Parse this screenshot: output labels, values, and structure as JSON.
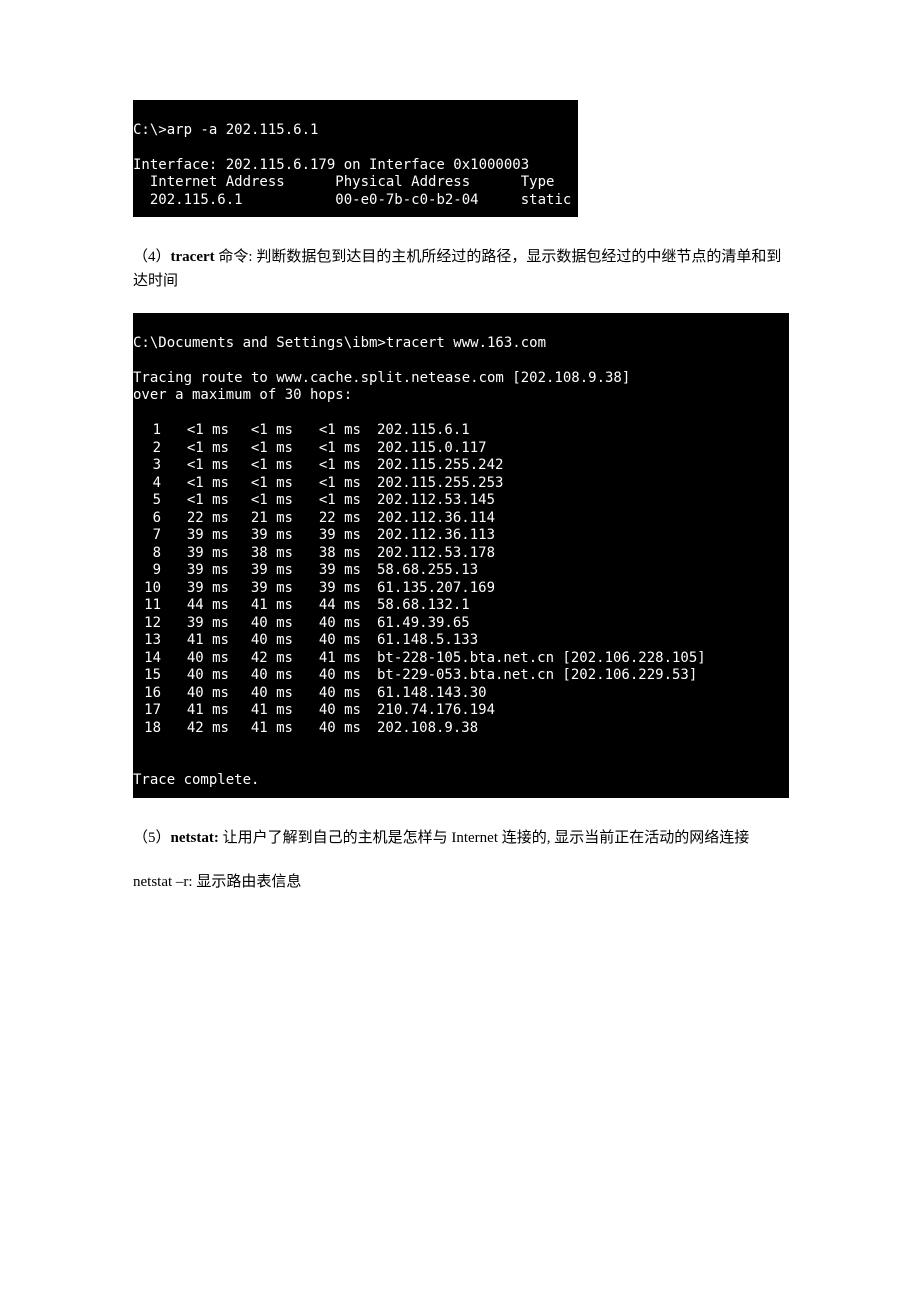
{
  "arp": {
    "prompt": "C:\\>arp -a 202.115.6.1",
    "interface_line": "Interface: 202.115.6.179 on Interface 0x1000003",
    "h1": "Internet Address",
    "h2": "Physical Address",
    "h3": "Type",
    "ip": "202.115.6.1",
    "mac": "00-e0-7b-c0-b2-04",
    "type": "static"
  },
  "p4": {
    "prefix": "（4）",
    "cmd": "tracert",
    "mid": " 命令:  ",
    "rest": "判断数据包到达目的主机所经过的路径，显示数据包经过的中继节点的清单和到达时间"
  },
  "tracert": {
    "prompt": "C:\\Documents and Settings\\ibm>tracert www.163.com",
    "tracing1": "Tracing route to www.cache.split.netease.com [202.108.9.38]",
    "tracing2": "over a maximum of 30 hops:",
    "complete": "Trace complete.",
    "hops": [
      {
        "n": "1",
        "a": "<1 ms",
        "b": "<1 ms",
        "c": "<1 ms",
        "d": "202.115.6.1"
      },
      {
        "n": "2",
        "a": "<1 ms",
        "b": "<1 ms",
        "c": "<1 ms",
        "d": "202.115.0.117"
      },
      {
        "n": "3",
        "a": "<1 ms",
        "b": "<1 ms",
        "c": "<1 ms",
        "d": "202.115.255.242"
      },
      {
        "n": "4",
        "a": "<1 ms",
        "b": "<1 ms",
        "c": "<1 ms",
        "d": "202.115.255.253"
      },
      {
        "n": "5",
        "a": "<1 ms",
        "b": "<1 ms",
        "c": "<1 ms",
        "d": "202.112.53.145"
      },
      {
        "n": "6",
        "a": "22 ms",
        "b": "21 ms",
        "c": "22 ms",
        "d": "202.112.36.114"
      },
      {
        "n": "7",
        "a": "39 ms",
        "b": "39 ms",
        "c": "39 ms",
        "d": "202.112.36.113"
      },
      {
        "n": "8",
        "a": "39 ms",
        "b": "38 ms",
        "c": "38 ms",
        "d": "202.112.53.178"
      },
      {
        "n": "9",
        "a": "39 ms",
        "b": "39 ms",
        "c": "39 ms",
        "d": "58.68.255.13"
      },
      {
        "n": "10",
        "a": "39 ms",
        "b": "39 ms",
        "c": "39 ms",
        "d": "61.135.207.169"
      },
      {
        "n": "11",
        "a": "44 ms",
        "b": "41 ms",
        "c": "44 ms",
        "d": "58.68.132.1"
      },
      {
        "n": "12",
        "a": "39 ms",
        "b": "40 ms",
        "c": "40 ms",
        "d": "61.49.39.65"
      },
      {
        "n": "13",
        "a": "41 ms",
        "b": "40 ms",
        "c": "40 ms",
        "d": "61.148.5.133"
      },
      {
        "n": "14",
        "a": "40 ms",
        "b": "42 ms",
        "c": "41 ms",
        "d": "bt-228-105.bta.net.cn [202.106.228.105]"
      },
      {
        "n": "15",
        "a": "40 ms",
        "b": "40 ms",
        "c": "40 ms",
        "d": "bt-229-053.bta.net.cn [202.106.229.53]"
      },
      {
        "n": "16",
        "a": "40 ms",
        "b": "40 ms",
        "c": "40 ms",
        "d": "61.148.143.30"
      },
      {
        "n": "17",
        "a": "41 ms",
        "b": "41 ms",
        "c": "40 ms",
        "d": "210.74.176.194"
      },
      {
        "n": "18",
        "a": "42 ms",
        "b": "41 ms",
        "c": "40 ms",
        "d": "202.108.9.38"
      }
    ]
  },
  "p5": {
    "prefix": "（5）",
    "cmd": "netstat:",
    "mid": " 让用户了解到自己的主机是怎样与 ",
    "internet": "Internet",
    "rest": " 连接的, 显示当前正在活动的网络连接"
  },
  "p5b": {
    "cmd": "netstat –r:",
    "rest": "  显示路由表信息"
  }
}
